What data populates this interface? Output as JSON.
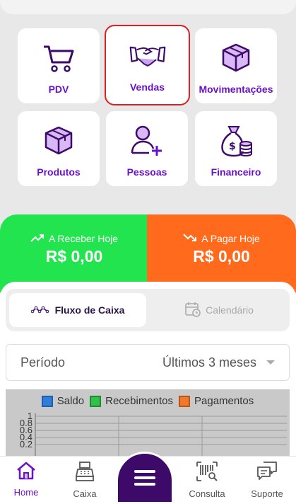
{
  "tiles": [
    {
      "label": "PDV",
      "icon": "cart-icon"
    },
    {
      "label": "Vendas",
      "icon": "handshake-icon"
    },
    {
      "label": "Movimentações",
      "icon": "box-icon"
    },
    {
      "label": "Produtos",
      "icon": "box-icon"
    },
    {
      "label": "Pessoas",
      "icon": "person-add-icon"
    },
    {
      "label": "Financeiro",
      "icon": "money-bag-icon"
    }
  ],
  "summary": {
    "receive": {
      "caption": "A Receber Hoje",
      "value": "R$ 0,00"
    },
    "pay": {
      "caption": "A Pagar Hoje",
      "value": "R$ 0,00"
    }
  },
  "tabs": {
    "flow": "Fluxo de Caixa",
    "calendar": "Calendário"
  },
  "period": {
    "label": "Período",
    "value": "Últimos 3 meses"
  },
  "chart_data": {
    "type": "bar",
    "categories": [],
    "series": [
      {
        "name": "Saldo",
        "values": []
      },
      {
        "name": "Recebimentos",
        "values": []
      },
      {
        "name": "Pagamentos",
        "values": []
      }
    ],
    "yticks": [
      "1",
      "0.8",
      "0.6",
      "0.4",
      "0.2"
    ],
    "ylim": [
      0,
      1
    ],
    "colors": [
      "#2f7fd8",
      "#2ec24a",
      "#f07a2c"
    ],
    "legend": "top",
    "grid": true
  },
  "nav": {
    "home": "Home",
    "caixa": "Caixa",
    "consulta": "Consulta",
    "suporte": "Suporte"
  },
  "colors": {
    "accent": "#6a11c9",
    "green": "#22e44f",
    "orange": "#ff6a1d",
    "fab": "#3d0a6a"
  }
}
